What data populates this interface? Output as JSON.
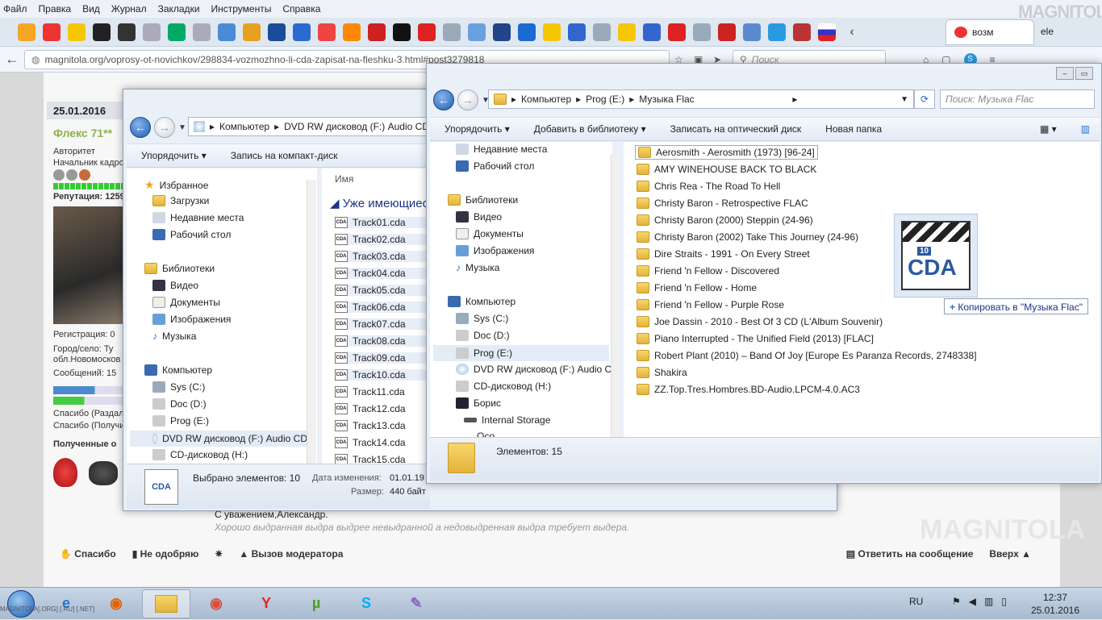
{
  "menu": [
    "Файл",
    "Правка",
    "Вид",
    "Журнал",
    "Закладки",
    "Инструменты",
    "Справка"
  ],
  "firefox_tab": {
    "label": "возм"
  },
  "tab_extra": "ele",
  "watermark": "MAGNITOLA",
  "url": "magnitola.org/voprosy-ot-novichkov/298834-vozmozhno-li-cda-zapisat-na-fleshku-3.html#post3279818",
  "search_placeholder": "Поиск",
  "forum": {
    "post_date": "25.01.2016",
    "username": "Флекс 71**",
    "rank1": "Авторитет",
    "rank2": "Начальник кадро",
    "reputation": "Репутация: 1259",
    "reg": "Регистрация: 0",
    "city": "Город/село: Ту",
    "region": "обл.Новомосков",
    "posts": "Сообщений: 15",
    "thanks_given": "Спасибо (Раздал",
    "thanks_got": "Спасибо (Получи",
    "received": "Полученные о",
    "signature": "С уважением,Александр.",
    "quote": "Хорошо выдранная выдра выдрее невыдранной а недовыдренная выдра требует выдера.",
    "actions": {
      "thanks": "Спасибо",
      "disapprove": "Не одобряю",
      "moderator": "Вызов модератора",
      "reply": "Ответить на сообщение",
      "up": "Вверх"
    }
  },
  "win_left": {
    "path": [
      "Компьютер",
      "DVD RW дисковод (F:) Audio CD"
    ],
    "cmd": {
      "organize": "Упорядочить",
      "burn": "Запись на компакт-диск"
    },
    "nav": {
      "favorites": "Избранное",
      "downloads": "Загрузки",
      "recent": "Недавние места",
      "desktop": "Рабочий стол",
      "libraries": "Библиотеки",
      "video": "Видео",
      "docs": "Документы",
      "images": "Изображения",
      "music": "Музыка",
      "computer": "Компьютер",
      "sysc": "Sys (C:)",
      "docd": "Doc (D:)",
      "proge": "Prog (E:)",
      "dvdf": "DVD RW дисковод (F:) Audio CD",
      "cdh": "CD-дисковод (H:)"
    },
    "col_name": "Имя",
    "group": "Уже имеющиес",
    "tracks": [
      "Track01.cda",
      "Track02.cda",
      "Track03.cda",
      "Track04.cda",
      "Track05.cda",
      "Track06.cda",
      "Track07.cda",
      "Track08.cda",
      "Track09.cda",
      "Track10.cda",
      "Track11.cda",
      "Track12.cda",
      "Track13.cda",
      "Track14.cda",
      "Track15.cda"
    ],
    "status": {
      "selected": "Выбрано элементов: 10",
      "modified_label": "Дата изменения:",
      "modified": "01.01.19",
      "size_label": "Размер:",
      "size": "440 байт"
    }
  },
  "win_right": {
    "path": [
      "Компьютер",
      "Prog (E:)",
      "Музыка Flac"
    ],
    "search": "Поиск: Музыка Flac",
    "cmd": {
      "organize": "Упорядочить",
      "library": "Добавить в библиотеку",
      "burn": "Записать на оптический диск",
      "newfolder": "Новая папка"
    },
    "nav": {
      "recent": "Недавние места",
      "desktop": "Рабочий стол",
      "libraries": "Библиотеки",
      "video": "Видео",
      "docs": "Документы",
      "images": "Изображения",
      "music": "Музыка",
      "computer": "Компьютер",
      "sysc": "Sys (C:)",
      "docd": "Doc (D:)",
      "proge": "Prog (E:)",
      "dvdf": "DVD RW дисковод (F:) Audio CD",
      "cdh": "CD-дисковод (H:)",
      "boris": "Борис",
      "storage": "Internal Storage",
      "partial": "Осо"
    },
    "folders": [
      "Aerosmith - Aerosmith (1973) [96-24]",
      "AMY WINEHOUSE BACK TO BLACK",
      "Chris Rea - The Road To Hell",
      "Christy Baron - Retrospective FLAC",
      "Christy Baron (2000) Steppin (24-96)",
      "Christy Baron (2002) Take This Journey (24-96)",
      "Dire Straits - 1991 - On Every Street",
      "Friend 'n Fellow - Discovered",
      "Friend 'n Fellow - Home",
      "Friend 'n Fellow - Purple Rose",
      "Joe Dassin - 2010 - Best Of 3 CD (L'Album Souvenir)",
      "Piano Interrupted - The Unified Field (2013) [FLAC]",
      "Robert Plant (2010) – Band Of Joy [Europe Es Paranza Records, 2748338]",
      "Shakira",
      "ZZ.Top.Tres.Hombres.BD-Audio.LPCM-4.0.AC3"
    ],
    "status": "Элементов: 15",
    "drag_tip": "Копировать в \"Музыка Flac\"",
    "drag_badge": "10",
    "drag_label": "CDA"
  },
  "taskbar": {
    "tray_lang": "RU",
    "time": "12:37",
    "date": "25.01.2016",
    "footer_watermark": "MAGNITOLA[.ORG] [.RU] [.NET]"
  }
}
